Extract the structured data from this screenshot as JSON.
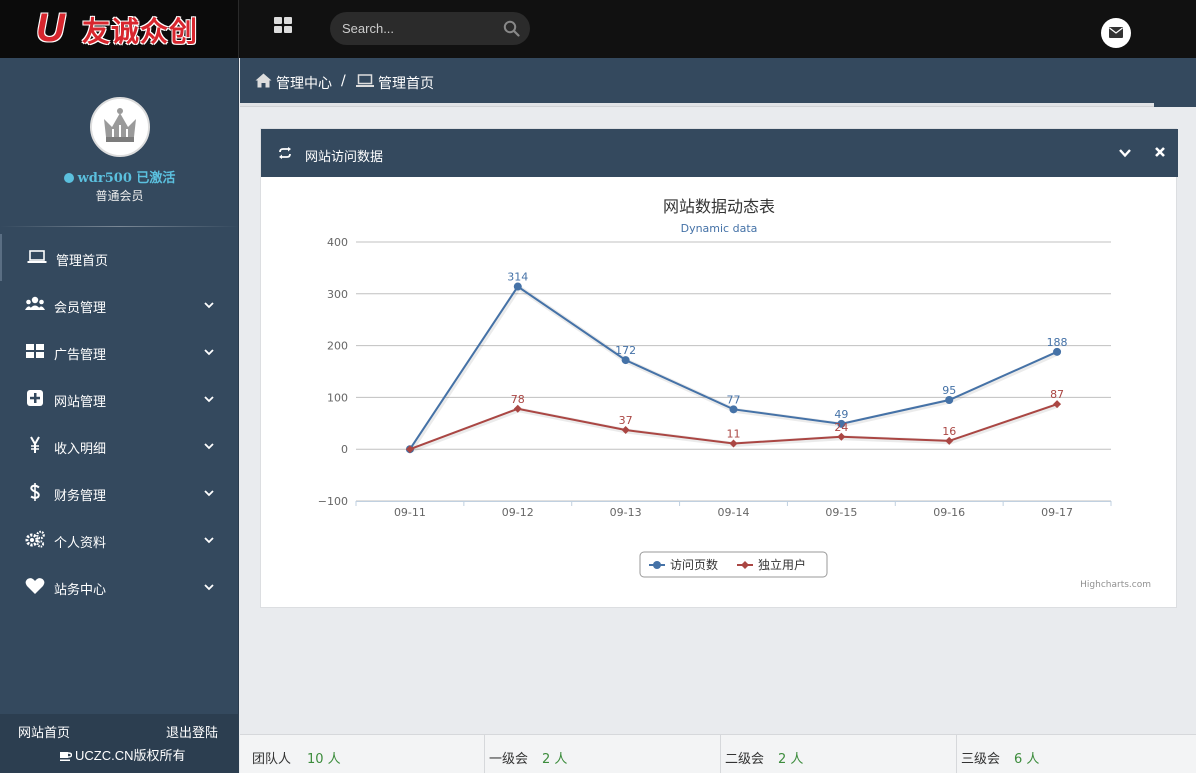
{
  "brand": {
    "logo_letter": "U",
    "name": "友诚众创"
  },
  "topbar": {
    "search_placeholder": "Search..."
  },
  "user": {
    "name": "wdr500 已激活",
    "role": "普通会员"
  },
  "menu": [
    {
      "label": "管理首页",
      "icon": "laptop-icon"
    },
    {
      "label": "会员管理",
      "icon": "users-icon"
    },
    {
      "label": "广告管理",
      "icon": "grid-icon"
    },
    {
      "label": "网站管理",
      "icon": "plus-square-icon"
    },
    {
      "label": "收入明细",
      "icon": "yen-icon"
    },
    {
      "label": "财务管理",
      "icon": "dollar-icon"
    },
    {
      "label": "个人资料",
      "icon": "gears-icon"
    },
    {
      "label": "站务中心",
      "icon": "heart-icon"
    }
  ],
  "sidebar_footer": {
    "home": "网站首页",
    "logout": "退出登陆",
    "copyright": "UCZC.CN版权所有"
  },
  "breadcrumb": {
    "root": "管理中心",
    "separator": "/",
    "current": "管理首页"
  },
  "panel": {
    "title": "网站访问数据"
  },
  "chart_data": {
    "type": "line",
    "title": "网站数据动态表",
    "subtitle": "Dynamic data",
    "categories": [
      "09-11",
      "09-12",
      "09-13",
      "09-14",
      "09-15",
      "09-16",
      "09-17"
    ],
    "ylim": [
      -100,
      400
    ],
    "yticks": [
      -100,
      0,
      100,
      200,
      300,
      400
    ],
    "grid": true,
    "legend": "bottom-center",
    "credit": "Highcharts.com",
    "series": [
      {
        "name": "访问页数",
        "color": "#4572a7",
        "values": [
          0,
          314,
          172,
          77,
          49,
          95,
          188
        ],
        "labels": [
          "",
          "314",
          "172",
          "77",
          "49",
          "95",
          "188"
        ]
      },
      {
        "name": "独立用户",
        "color": "#aa4643",
        "values": [
          0,
          78,
          37,
          11,
          24,
          16,
          87
        ],
        "labels": [
          "",
          "78",
          "37",
          "11",
          "24",
          "16",
          "87"
        ]
      }
    ]
  },
  "stats": [
    {
      "label": "团队人",
      "value": "10 人"
    },
    {
      "label": "一级会",
      "value": "2 人"
    },
    {
      "label": "二级会",
      "value": "2 人"
    },
    {
      "label": "三级会",
      "value": "6 人"
    }
  ]
}
